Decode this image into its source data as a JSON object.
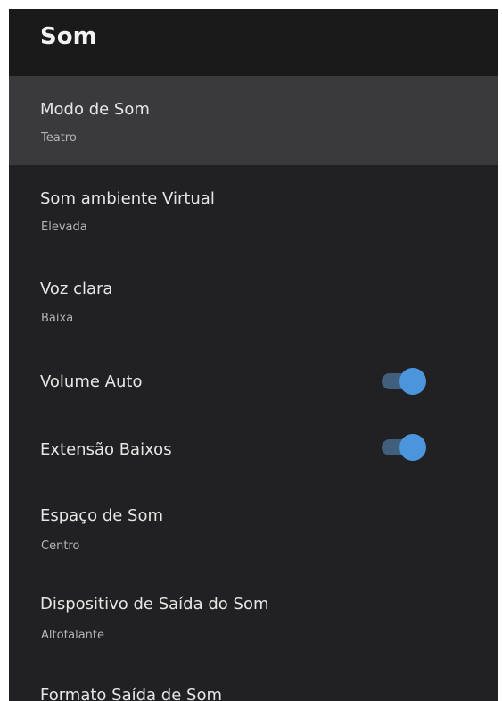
{
  "header": {
    "title": "Som"
  },
  "items": [
    {
      "title": "Modo de Som",
      "subtitle": "Teatro",
      "selected": true
    },
    {
      "title": "Som ambiente Virtual",
      "subtitle": "Elevada"
    },
    {
      "title": "Voz clara",
      "subtitle": "Baixa"
    },
    {
      "title": "Volume Auto",
      "toggle": true,
      "toggle_on": true
    },
    {
      "title": "Extensão Baixos",
      "toggle": true,
      "toggle_on": true
    },
    {
      "title": "Espaço de Som",
      "subtitle": "Centro"
    },
    {
      "title": "Dispositivo de Saída do Som",
      "subtitle": "Altofalante"
    },
    {
      "title": "Formato Saída de Som"
    }
  ],
  "colors": {
    "background": "#212123",
    "header": "#1a1a1b",
    "selected": "#3a3a3c",
    "toggle_track": "#3f5f7c",
    "toggle_knob": "#4a95dc"
  }
}
